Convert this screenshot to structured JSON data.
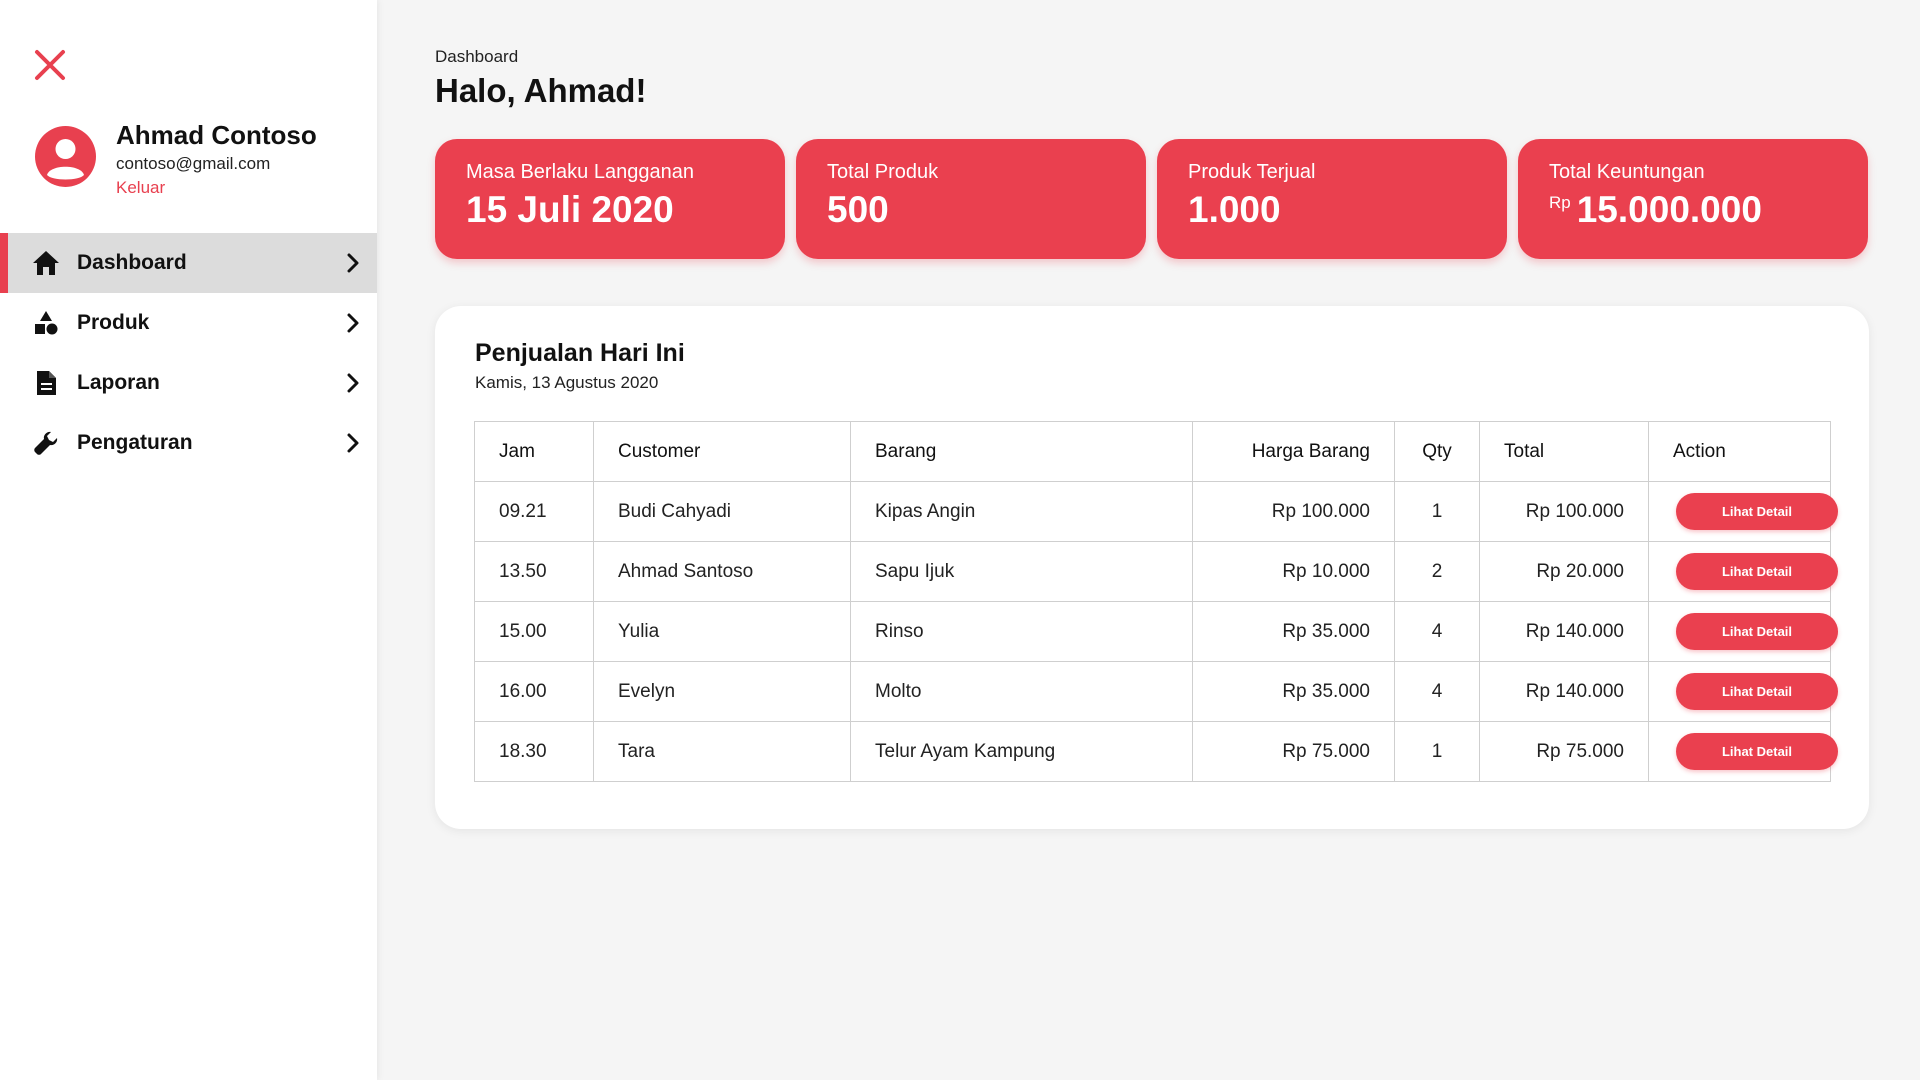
{
  "colors": {
    "accent": "#ea404f",
    "sidebar_active": "#dcdcdc",
    "background": "#f5f5f5"
  },
  "sidebar": {
    "close_icon": "close-icon",
    "profile": {
      "avatar_icon": "user-avatar-icon",
      "name": "Ahmad Contoso",
      "email": "contoso@gmail.com",
      "logout": "Keluar"
    },
    "items": [
      {
        "label": "Dashboard",
        "icon": "home-icon",
        "active": true
      },
      {
        "label": "Produk",
        "icon": "shapes-icon",
        "active": false
      },
      {
        "label": "Laporan",
        "icon": "document-icon",
        "active": false
      },
      {
        "label": "Pengaturan",
        "icon": "wrench-icon",
        "active": false
      }
    ]
  },
  "header": {
    "breadcrumb": "Dashboard",
    "greeting": "Halo, Ahmad!"
  },
  "stats": [
    {
      "label": "Masa Berlaku Langganan",
      "value": "15 Juli 2020",
      "currency": ""
    },
    {
      "label": "Total Produk",
      "value": "500",
      "currency": ""
    },
    {
      "label": "Produk Terjual",
      "value": "1.000",
      "currency": ""
    },
    {
      "label": "Total Keuntungan",
      "value": "15.000.000",
      "currency": "Rp"
    }
  ],
  "sales": {
    "title": "Penjualan Hari Ini",
    "date": "Kamis, 13 Agustus 2020",
    "columns": [
      "Jam",
      "Customer",
      "Barang",
      "Harga Barang",
      "Qty",
      "Total",
      "Action"
    ],
    "button_label": "Lihat Detail",
    "rows": [
      {
        "jam": "09.21",
        "customer": "Budi Cahyadi",
        "barang": "Kipas Angin",
        "harga": "Rp 100.000",
        "qty": "1",
        "total": "Rp 100.000"
      },
      {
        "jam": "13.50",
        "customer": "Ahmad Santoso",
        "barang": "Sapu Ijuk",
        "harga": "Rp 10.000",
        "qty": "2",
        "total": "Rp 20.000"
      },
      {
        "jam": "15.00",
        "customer": "Yulia",
        "barang": "Rinso",
        "harga": "Rp 35.000",
        "qty": "4",
        "total": "Rp 140.000"
      },
      {
        "jam": "16.00",
        "customer": "Evelyn",
        "barang": "Molto",
        "harga": "Rp 35.000",
        "qty": "4",
        "total": "Rp 140.000"
      },
      {
        "jam": "18.30",
        "customer": "Tara",
        "barang": "Telur Ayam Kampung",
        "harga": "Rp 75.000",
        "qty": "1",
        "total": "Rp 75.000"
      }
    ]
  }
}
